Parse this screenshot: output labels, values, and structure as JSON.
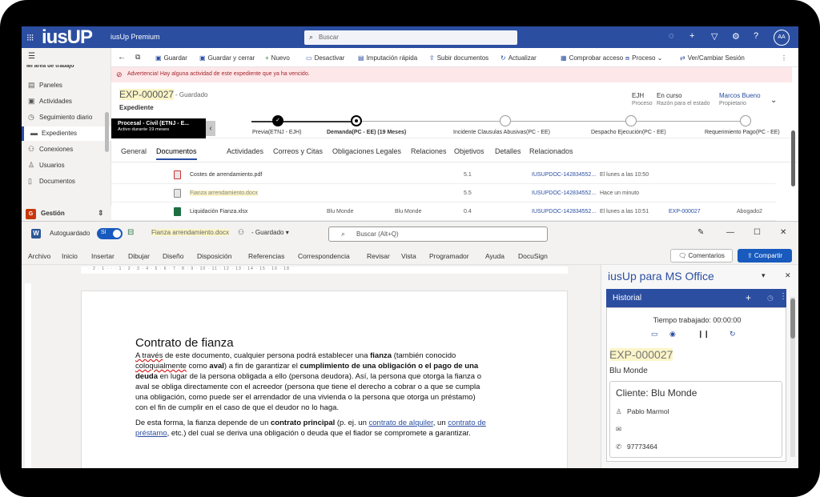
{
  "crm": {
    "logo": "iusUP",
    "app_name": "iusUp Premium",
    "search_placeholder": "Buscar",
    "avatar": "AA",
    "sidebar": {
      "partial_title": "Mi área de trabajo",
      "items": [
        {
          "label": "Paneles",
          "icon": "dashboard-icon"
        },
        {
          "label": "Actividades",
          "icon": "clipboard-icon"
        },
        {
          "label": "Seguimiento diario",
          "icon": "clock-icon"
        },
        {
          "label": "Expedientes",
          "icon": "folder-icon"
        },
        {
          "label": "Conexiones",
          "icon": "people-icon"
        },
        {
          "label": "Usuarios",
          "icon": "person-icon"
        },
        {
          "label": "Documentos",
          "icon": "document-icon"
        }
      ],
      "area_letter": "G",
      "area_label": "Gestión"
    },
    "commands": [
      "Guardar",
      "Guardar y cerrar",
      "Nuevo",
      "Desactivar",
      "Imputación rápida",
      "Subir documentos",
      "Actualizar",
      "Comprobar acceso",
      "Proceso",
      "Ver/Cambiar Sesión"
    ],
    "warning": "Advertencia! Hay alguna actividad de este expediente que ya ha vencido.",
    "record": {
      "id": "EXP-000027",
      "saved": "- Guardado",
      "entity": "Expediente",
      "fields": [
        {
          "value": "EJH",
          "label": "Proceso"
        },
        {
          "value": "En curso",
          "label": "Razón para el estado"
        },
        {
          "value": "Marcos Bueno",
          "label": "Propietario"
        }
      ]
    },
    "bpf": {
      "stage_name": "Procesal - Civil (ETNJ - E...",
      "stage_sub": "Activo durante 19 meses",
      "stages": [
        "Previa(ETNJ - EJH)",
        "Demanda(PC - EE)  (19 Meses)",
        "Incidente Clausulas Abusivas(PC - EE)",
        "Despacho Ejecución(PC - EE)",
        "Requerimiento Pago(PC - EE)"
      ]
    },
    "tabs": [
      "General",
      "Documentos",
      "Actividades",
      "Correos y Citas",
      "Obligaciones Legales",
      "Relaciones",
      "Objetivos",
      "Detalles",
      "Relacionados"
    ],
    "docs": [
      {
        "name": "Costes de arrendamiento.pdf",
        "c1": "",
        "c2": "",
        "ver": "5.1",
        "ref": "IUSUPDOC-142834552...",
        "date": "El lunes a las 10:50",
        "exp": "",
        "role": ""
      },
      {
        "name": "Fianza arrendamiento.docx",
        "c1": "",
        "c2": "",
        "ver": "5.5",
        "ref": "IUSUPDOC-142834552...",
        "date": "Hace un minuto",
        "exp": "",
        "role": ""
      },
      {
        "name": "Liquidación Fianza.xlsx",
        "c1": "Blu Monde",
        "c2": "Blu Monde",
        "ver": "0.4",
        "ref": "IUSUPDOC-142834552...",
        "date": "El lunes a las 10:51",
        "exp": "EXP-000027",
        "role": "Abogado2"
      }
    ]
  },
  "word": {
    "autosave": "Autoguardado",
    "toggle": "Sí",
    "doc_name": "Fianza arrendamiento.docx",
    "status": "- Guardado",
    "search": "Buscar (Alt+Q)",
    "ribbon": [
      "Archivo",
      "Inicio",
      "Insertar",
      "Dibujar",
      "Diseño",
      "Disposición",
      "Referencias",
      "Correspondencia",
      "Revisar",
      "Vista",
      "Programador",
      "Ayuda",
      "DocuSign"
    ],
    "comments": "Comentarios",
    "share": "Compartir",
    "ruler": "· 2 · 1 · · · 1 · 2 · 3 · 4 · 5 · 6 · 7 · 8 · 9 · 10 · 11 · 12 · 13 · 14 · 15 · 16 · 18",
    "doc_title": "Contrato de fianza"
  },
  "pane": {
    "title": "iusUp para MS Office",
    "history": "Historial",
    "time": "Tiempo trabajado: 00:00:00",
    "exp": "EXP-000027",
    "client": "Blu Monde",
    "card_title": "Cliente: Blu Monde",
    "contact": "Pablo Marmol",
    "phone": "97773464"
  }
}
